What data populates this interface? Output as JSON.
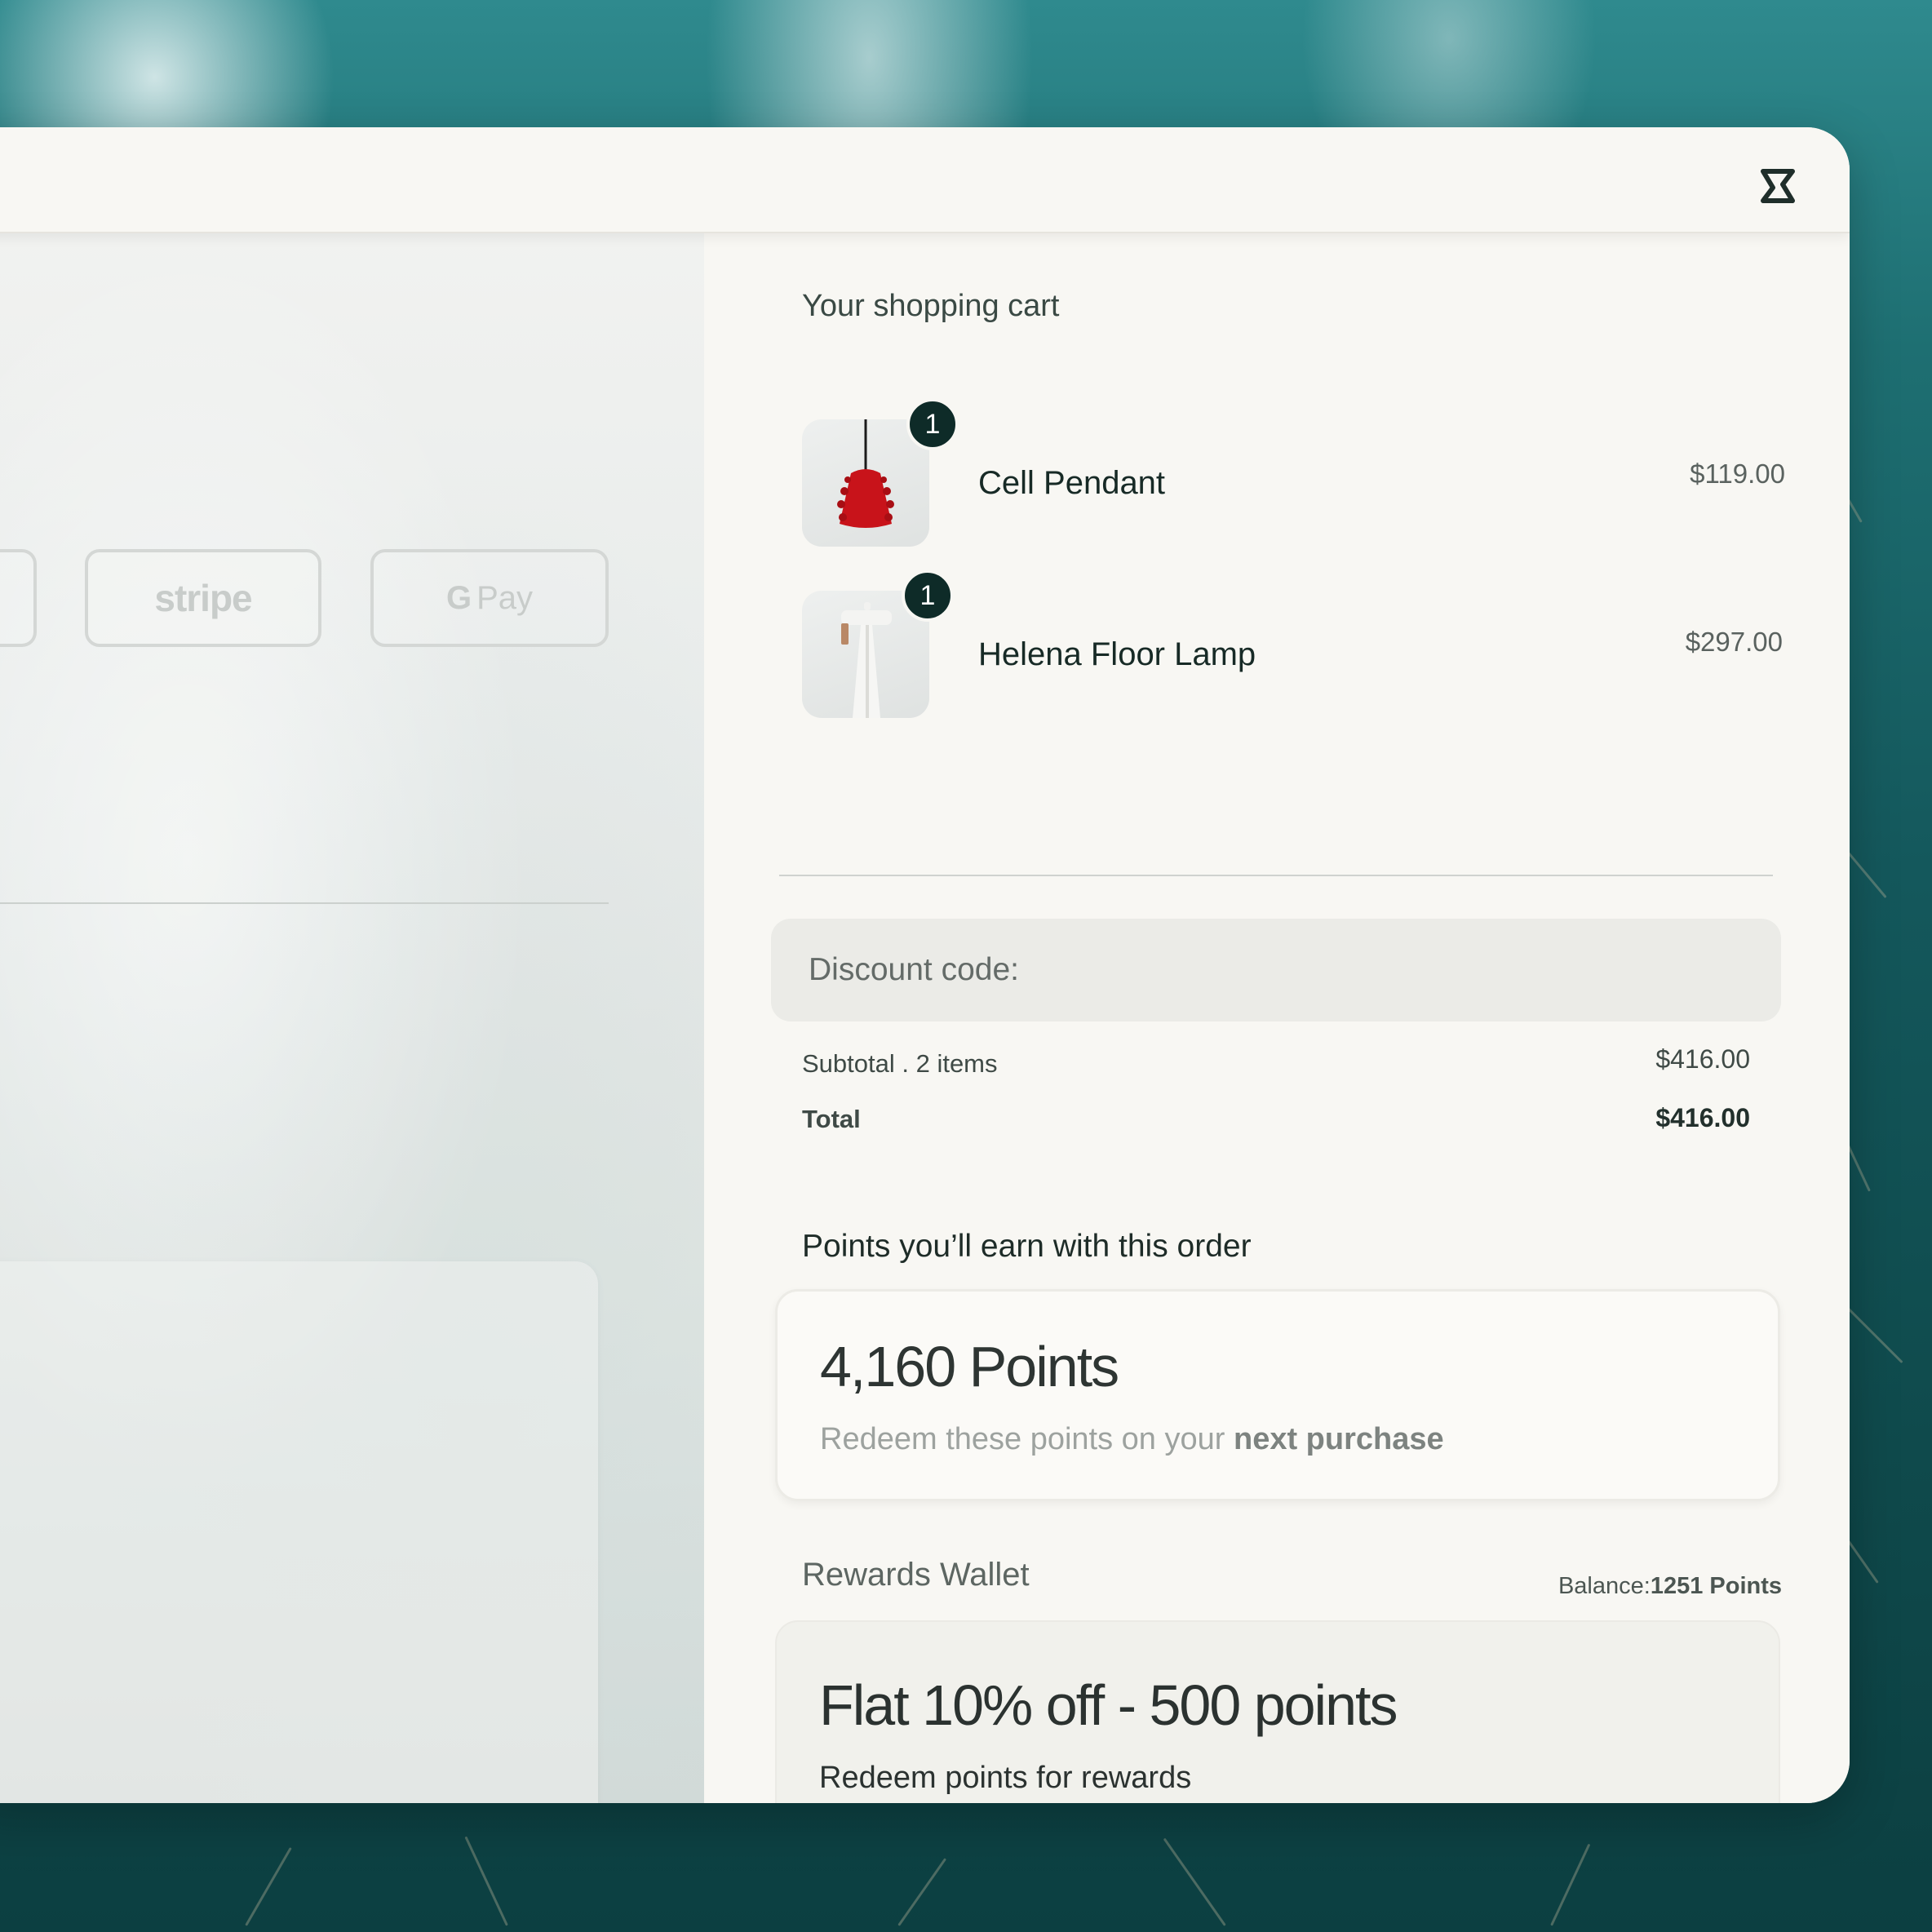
{
  "payment_methods": {
    "first_label": "",
    "stripe_label": "stripe",
    "gpay_g": "G",
    "gpay_label": "Pay"
  },
  "cart": {
    "title": "Your shopping cart",
    "items": [
      {
        "name": "Cell Pendant",
        "price": "$119.00",
        "quantity": "1",
        "icon": "pendant-lamp-image"
      },
      {
        "name": "Helena Floor Lamp",
        "price": "$297.00",
        "quantity": "1",
        "icon": "floor-lamp-image"
      }
    ],
    "discount_label": "Discount code:",
    "subtotal_label": "Subtotal . 2 items",
    "subtotal_value": "$416.00",
    "total_label": "Total",
    "total_value": "$416.00"
  },
  "points": {
    "title": "Points you’ll earn with this order",
    "amount": "4,160 Points",
    "sub_prefix": "Redeem these points on your ",
    "sub_bold": "next purchase"
  },
  "wallet": {
    "title": "Rewards Wallet",
    "balance_label": "Balance:",
    "balance_value": "1251 Points",
    "reward_title": "Flat 10% off - 500 points",
    "reward_sub": "Redeem points for rewards"
  },
  "colors": {
    "badge": "#0e2b28",
    "background_water": "#1e6f72",
    "panel": "#f8f7f3"
  }
}
